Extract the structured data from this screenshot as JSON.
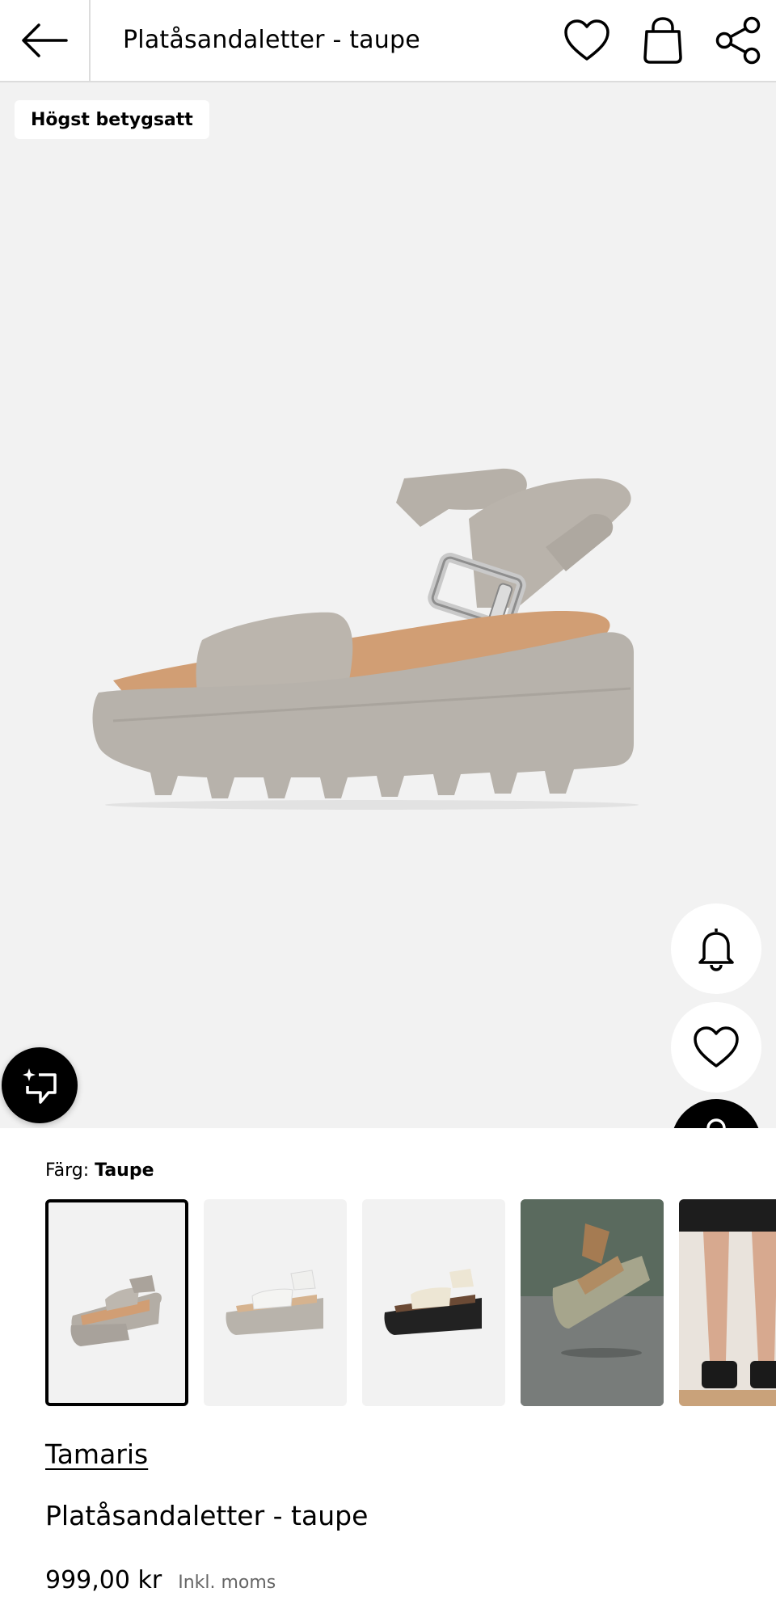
{
  "header": {
    "title": "Platåsandaletter - taupe",
    "icons": [
      "arrow-left-icon",
      "heart-icon",
      "shopping-bag-icon",
      "share-icon"
    ]
  },
  "hero": {
    "badge": "Högst betygsatt",
    "buttons": [
      "bell-icon",
      "heart-icon",
      "search-icon",
      "sparkle-compare-icon"
    ]
  },
  "color": {
    "label": "Färg:",
    "value": "Taupe"
  },
  "thumbnails": [
    {
      "alt": "taupe sandal front angle",
      "selected": true
    },
    {
      "alt": "white sandal side",
      "selected": false
    },
    {
      "alt": "cream black sandal side",
      "selected": false
    },
    {
      "alt": "leopard sandal lifestyle",
      "selected": false
    },
    {
      "alt": "model wearing black sandals",
      "selected": false
    }
  ],
  "product": {
    "brand": "Tamaris",
    "name": "Platåsandaletter - taupe",
    "price": "999,00 kr",
    "vat_note": "Inkl. moms"
  },
  "colors": {
    "hero_bg": "#f2f2f2",
    "shoe_taupe": "#b7b2ab",
    "insole_tan": "#d19e74"
  }
}
